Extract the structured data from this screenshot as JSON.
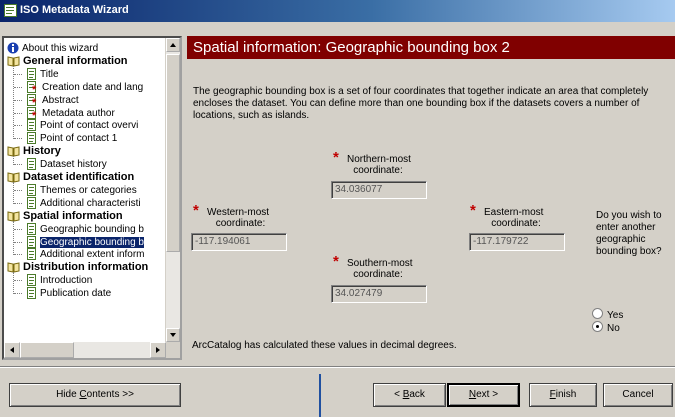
{
  "window": {
    "title": "ISO Metadata Wizard"
  },
  "tree": {
    "items": [
      {
        "label": "About this wizard",
        "icon": "info-icon",
        "bold": false,
        "level": 0
      },
      {
        "label": "General information",
        "icon": "book-icon",
        "bold": true,
        "level": 0
      },
      {
        "label": "Title",
        "icon": "page-icon",
        "bold": false,
        "level": 1
      },
      {
        "label": "Creation date and lang",
        "icon": "page-required-icon",
        "bold": false,
        "level": 1
      },
      {
        "label": "Abstract",
        "icon": "page-required-icon",
        "bold": false,
        "level": 1
      },
      {
        "label": "Metadata author",
        "icon": "page-required-icon",
        "bold": false,
        "level": 1
      },
      {
        "label": "Point of contact overvi",
        "icon": "page-icon",
        "bold": false,
        "level": 1
      },
      {
        "label": "Point of contact 1",
        "icon": "page-icon",
        "bold": false,
        "level": 1
      },
      {
        "label": "History",
        "icon": "book-icon",
        "bold": true,
        "level": 0
      },
      {
        "label": "Dataset history",
        "icon": "page-icon",
        "bold": false,
        "level": 1
      },
      {
        "label": "Dataset identification",
        "icon": "book-icon",
        "bold": true,
        "level": 0
      },
      {
        "label": "Themes or categories",
        "icon": "page-icon",
        "bold": false,
        "level": 1
      },
      {
        "label": "Additional characteristi",
        "icon": "page-icon",
        "bold": false,
        "level": 1
      },
      {
        "label": "Spatial information",
        "icon": "book-icon",
        "bold": true,
        "level": 0
      },
      {
        "label": "Geographic bounding b",
        "icon": "page-icon",
        "bold": false,
        "level": 1
      },
      {
        "label": "Geographic bounding b",
        "icon": "page-icon",
        "bold": false,
        "level": 1,
        "selected": true
      },
      {
        "label": "Additional extent inform",
        "icon": "page-icon",
        "bold": false,
        "level": 1
      },
      {
        "label": "Distribution information",
        "icon": "book-icon",
        "bold": true,
        "level": 0
      },
      {
        "label": "Introduction",
        "icon": "page-icon",
        "bold": false,
        "level": 1
      },
      {
        "label": "Publication date",
        "icon": "page-icon",
        "bold": false,
        "level": 1
      }
    ]
  },
  "panel": {
    "heading": "Spatial information: Geographic bounding box 2",
    "description": "The geographic bounding box is a set of four coordinates that together indicate an area that completely encloses the dataset. You can define more than one bounding box if the datasets covers a number of locations, such as islands.",
    "north": {
      "label_line1": "Northern-most",
      "label_line2": "coordinate:",
      "value": "34.036077"
    },
    "west": {
      "label_line1": "Western-most",
      "label_line2": "coordinate:",
      "value": "-117.194061"
    },
    "east": {
      "label_line1": "Eastern-most",
      "label_line2": "coordinate:",
      "value": "-117.179722"
    },
    "south": {
      "label_line1": "Southern-most",
      "label_line2": "coordinate:",
      "value": "34.027479"
    },
    "required_marker": "*",
    "another_box_question": "Do you wish to enter another geographic bounding box?",
    "radio_yes": "Yes",
    "radio_no": "No",
    "selected_option": "No",
    "calc_note": "ArcCatalog has calculated these values in decimal degrees."
  },
  "buttons": {
    "hide_contents": {
      "pre": "Hide ",
      "mn": "C",
      "post": "ontents >>"
    },
    "back": {
      "pre": "< ",
      "mn": "B",
      "post": "ack"
    },
    "next": {
      "pre": "",
      "mn": "N",
      "post": "ext >"
    },
    "finish": {
      "pre": "",
      "mn": "F",
      "post": "inish"
    },
    "cancel": {
      "pre": "Cancel",
      "mn": "",
      "post": ""
    }
  },
  "colors": {
    "heading_bg": "#800000",
    "required_star": "#c00000",
    "selection": "#0a246a"
  }
}
